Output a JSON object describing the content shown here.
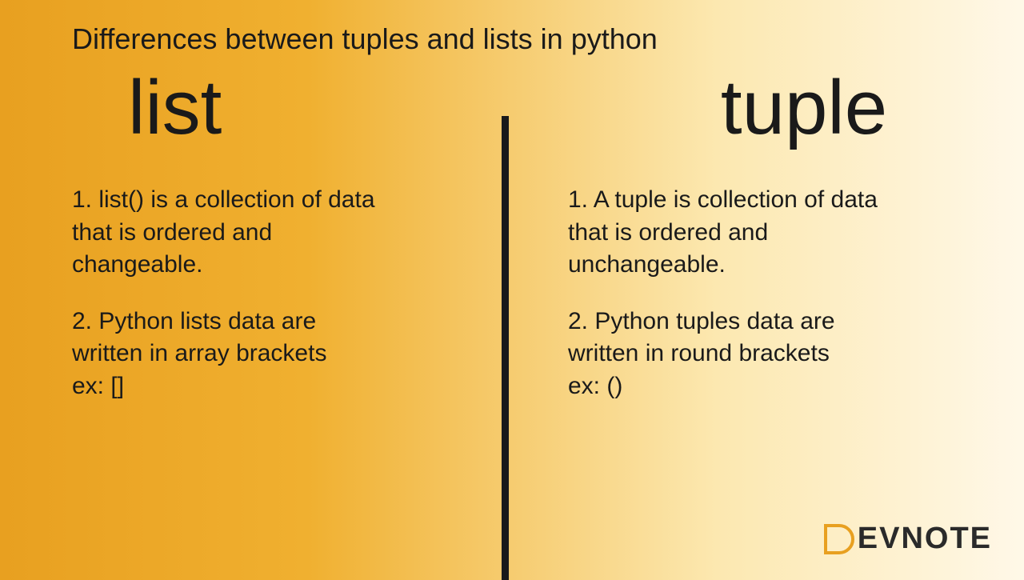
{
  "title": "Differences between tuples and lists in python",
  "left": {
    "heading": "list",
    "point1": "1. list() is a collection of data\n that is ordered and\nchangeable.",
    "point2": "2. Python lists data are\nwritten in array brackets\nex: []"
  },
  "right": {
    "heading": "tuple",
    "point1": "1. A tuple is collection of data\nthat is ordered and\nunchangeable.",
    "point2": "2. Python tuples data are\nwritten in round brackets\n ex: ()"
  },
  "logo_text": "EVNOTE"
}
